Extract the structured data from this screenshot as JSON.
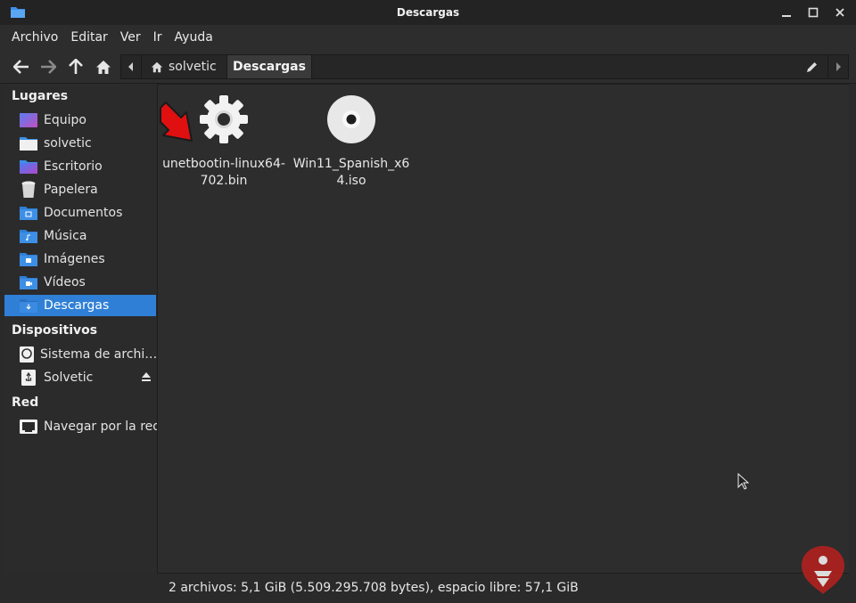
{
  "window": {
    "title": "Descargas"
  },
  "menu": [
    "Archivo",
    "Editar",
    "Ver",
    "Ir",
    "Ayuda"
  ],
  "path": {
    "home": "solvetic",
    "current": "Descargas"
  },
  "sidebar": {
    "sections": [
      {
        "title": "Lugares",
        "items": [
          {
            "label": "Equipo",
            "icon": "computer-icon"
          },
          {
            "label": "solvetic",
            "icon": "home-folder-icon"
          },
          {
            "label": "Escritorio",
            "icon": "desktop-folder-icon"
          },
          {
            "label": "Papelera",
            "icon": "trash-icon"
          },
          {
            "label": "Documentos",
            "icon": "documents-folder-icon"
          },
          {
            "label": "Música",
            "icon": "music-folder-icon"
          },
          {
            "label": "Imágenes",
            "icon": "pictures-folder-icon"
          },
          {
            "label": "Vídeos",
            "icon": "videos-folder-icon"
          },
          {
            "label": "Descargas",
            "icon": "downloads-folder-icon",
            "active": true
          }
        ]
      },
      {
        "title": "Dispositivos",
        "items": [
          {
            "label": "Sistema de archi…",
            "icon": "drive-icon"
          },
          {
            "label": "Solvetic",
            "icon": "usb-drive-icon",
            "eject": true
          }
        ]
      },
      {
        "title": "Red",
        "items": [
          {
            "label": "Navegar por la red",
            "icon": "network-icon"
          }
        ]
      }
    ]
  },
  "files": [
    {
      "name": "unetbootin-linux64-702.bin",
      "icon": "gear-icon"
    },
    {
      "name": "Win11_Spanish_x64.iso",
      "icon": "disc-icon"
    }
  ],
  "status": "2 archivos: 5,1 GiB (5.509.295.708 bytes), espacio libre: 57,1 GiB",
  "colors": {
    "accent": "#2f7fd6",
    "folder": "#3d8fe6",
    "arrow": "#e01010"
  }
}
